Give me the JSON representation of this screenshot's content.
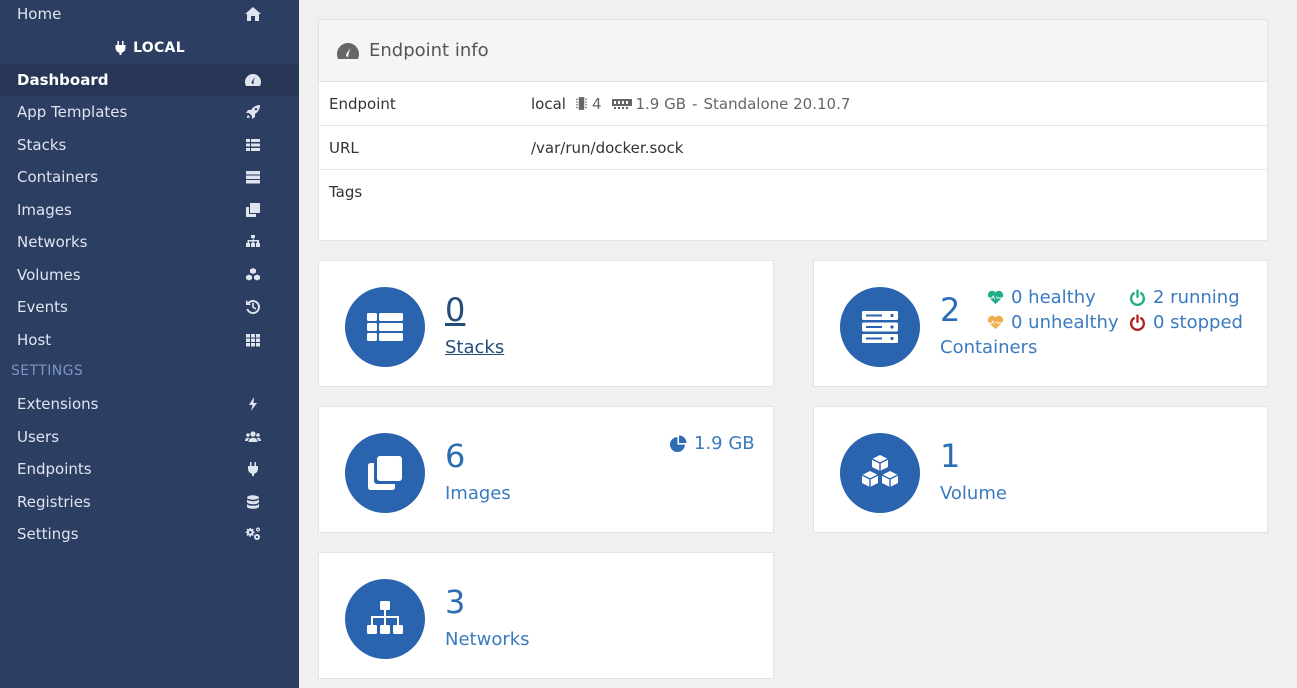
{
  "sidebar": {
    "home_label": "Home",
    "local_label": "LOCAL",
    "items": [
      {
        "label": "Dashboard",
        "icon": "tachometer-icon"
      },
      {
        "label": "App Templates",
        "icon": "rocket-icon"
      },
      {
        "label": "Stacks",
        "icon": "th-list-icon"
      },
      {
        "label": "Containers",
        "icon": "server-icon"
      },
      {
        "label": "Images",
        "icon": "clone-icon"
      },
      {
        "label": "Networks",
        "icon": "sitemap-icon"
      },
      {
        "label": "Volumes",
        "icon": "cubes-icon"
      },
      {
        "label": "Events",
        "icon": "history-icon"
      },
      {
        "label": "Host",
        "icon": "th-icon"
      }
    ],
    "settings_header": "SETTINGS",
    "settings_items": [
      {
        "label": "Extensions",
        "icon": "bolt-icon"
      },
      {
        "label": "Users",
        "icon": "users-icon"
      },
      {
        "label": "Endpoints",
        "icon": "plug-icon"
      },
      {
        "label": "Registries",
        "icon": "database-icon"
      },
      {
        "label": "Settings",
        "icon": "cogs-icon"
      }
    ]
  },
  "endpoint_info": {
    "title": "Endpoint info",
    "endpoint_key": "Endpoint",
    "endpoint_name": "local",
    "cpu": "4",
    "memory": "1.9 GB",
    "separator": "-",
    "mode": "Standalone 20.10.7",
    "url_key": "URL",
    "url_value": "/var/run/docker.sock",
    "tags_key": "Tags"
  },
  "cards": {
    "stacks": {
      "count": "0",
      "label": "Stacks"
    },
    "containers": {
      "count": "2",
      "label": "Containers",
      "healthy": "0 healthy",
      "unhealthy": "0 unhealthy",
      "running": "2 running",
      "stopped": "0 stopped"
    },
    "images": {
      "count": "6",
      "label": "Images",
      "size": "1.9 GB"
    },
    "volumes": {
      "count": "1",
      "label": "Volume"
    },
    "networks": {
      "count": "3",
      "label": "Networks"
    }
  },
  "colors": {
    "sidebar_bg": "#2d3e63",
    "accent": "#2a63ae",
    "healthy": "#23ae89",
    "unhealthy": "#f0ad4e",
    "running": "#23ae89",
    "stopped": "#ae2323"
  }
}
